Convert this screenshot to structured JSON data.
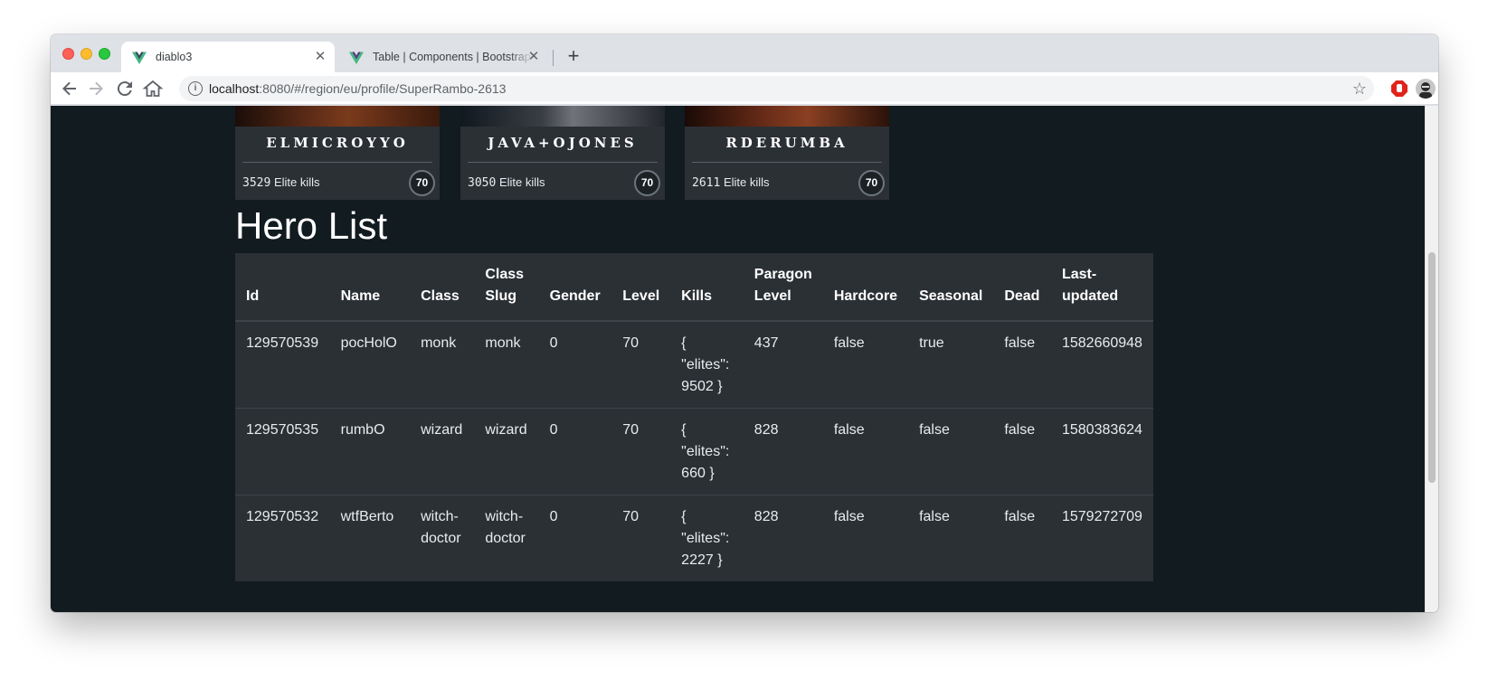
{
  "browser": {
    "tabs": [
      {
        "title": "diablo3",
        "active": true,
        "icon": "vue-logo-icon"
      },
      {
        "title": "Table | Components | Bootstrap",
        "active": false,
        "icon": "bootstrap-vue-logo-icon"
      }
    ],
    "new_tab": "+",
    "url_host": "localhost",
    "url_path": ":8080/#/region/eu/profile/SuperRambo-2613"
  },
  "hero_cards": [
    {
      "name": "ELMICROYYO",
      "kills": "3529",
      "kills_label": "Elite kills",
      "level": "70"
    },
    {
      "name": "JAVA+OJONES",
      "kills": "3050",
      "kills_label": "Elite kills",
      "level": "70"
    },
    {
      "name": "RDERUMBA",
      "kills": "2611",
      "kills_label": "Elite kills",
      "level": "70"
    }
  ],
  "hero_list": {
    "title": "Hero List",
    "headers": [
      "Id",
      "Name",
      "Class",
      "Class Slug",
      "Gender",
      "Level",
      "Kills",
      "Paragon Level",
      "Hardcore",
      "Seasonal",
      "Dead",
      "Last-updated"
    ],
    "rows": [
      [
        "129570539",
        "pocHolO",
        "monk",
        "monk",
        "0",
        "70",
        "{ \"elites\": 9502 }",
        "437",
        "false",
        "true",
        "false",
        "1582660948"
      ],
      [
        "129570535",
        "rumbO",
        "wizard",
        "wizard",
        "0",
        "70",
        "{ \"elites\": 660 }",
        "828",
        "false",
        "false",
        "false",
        "1580383624"
      ],
      [
        "129570532",
        "wtfBerto",
        "witch-doctor",
        "witch-doctor",
        "0",
        "70",
        "{ \"elites\": 2227 }",
        "828",
        "false",
        "false",
        "false",
        "1579272709"
      ]
    ]
  },
  "colors": {
    "page_background": "#111b20",
    "card_background": "#2b3035",
    "table_background": "#2b3035"
  }
}
